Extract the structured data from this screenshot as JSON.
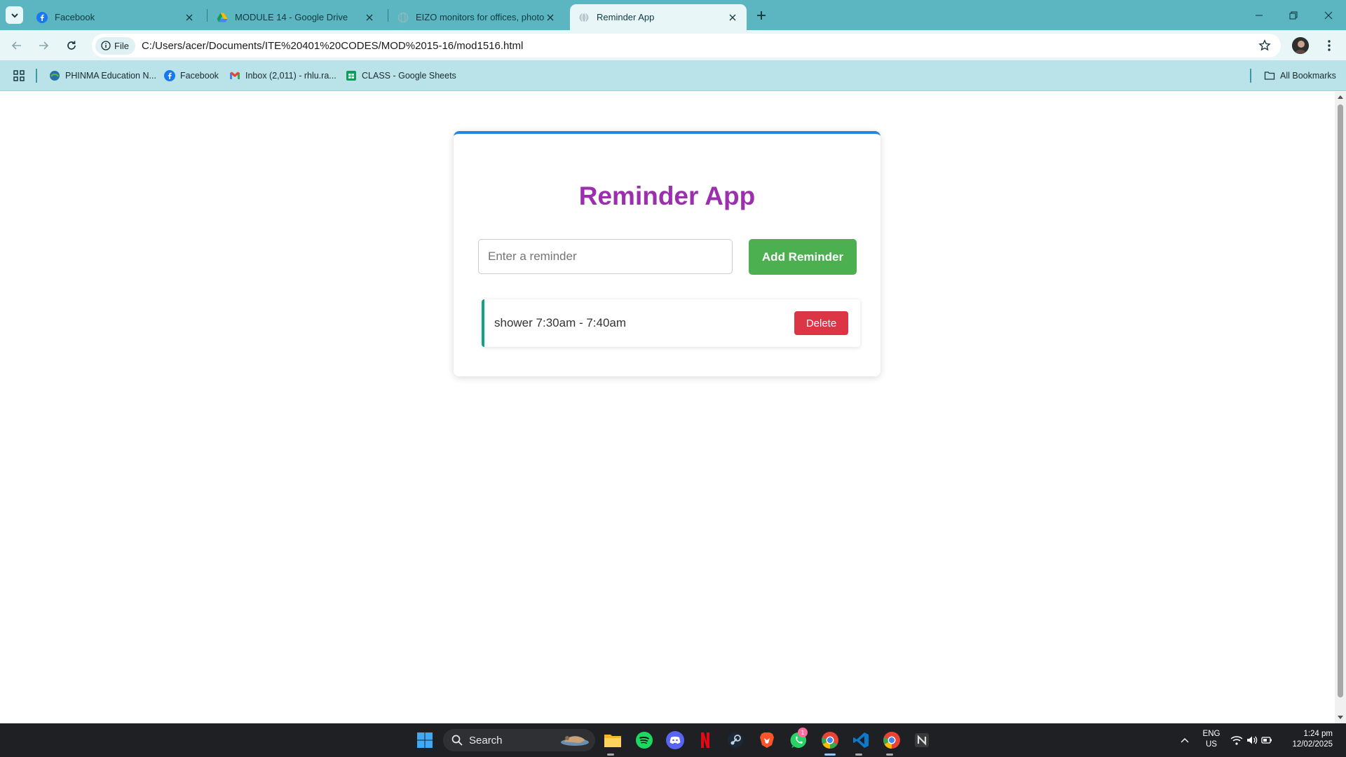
{
  "browser": {
    "tabs": [
      {
        "title": "Facebook",
        "icon": "facebook-icon"
      },
      {
        "title": "MODULE 14 - Google Drive",
        "icon": "google-drive-icon"
      },
      {
        "title": "EIZO monitors for offices, photos a",
        "icon": "globe-icon"
      },
      {
        "title": "Reminder App",
        "icon": "globe-icon",
        "active": true
      }
    ],
    "address": {
      "chip_label": "File",
      "url": "C:/Users/acer/Documents/ITE%20401%20CODES/MOD%2015-16/mod1516.html"
    },
    "bookmarks": [
      {
        "label": "PHINMA Education N...",
        "icon": "phinma-icon"
      },
      {
        "label": "Facebook",
        "icon": "facebook-icon"
      },
      {
        "label": "Inbox (2,011) - rhlu.ra...",
        "icon": "gmail-icon"
      },
      {
        "label": "CLASS - Google Sheets",
        "icon": "sheets-icon"
      }
    ],
    "all_bookmarks_label": "All Bookmarks"
  },
  "app": {
    "title": "Reminder App",
    "input_placeholder": "Enter a reminder",
    "input_value": "",
    "add_button_label": "Add Reminder",
    "delete_label": "Delete",
    "reminders": [
      {
        "text": "shower 7:30am - 7:40am"
      }
    ],
    "colors": {
      "title": "#9b2fae",
      "card_top_border": "#2387e4",
      "add_button": "#4caf50",
      "delete_button": "#dc3545",
      "item_accent": "#18a085"
    }
  },
  "taskbar": {
    "search_label": "Search",
    "apps": [
      "windows-start-icon",
      "file-explorer-icon",
      "spotify-icon",
      "discord-icon",
      "netflix-icon",
      "steam-icon",
      "brave-icon",
      "whatsapp-icon",
      "chrome-icon",
      "vscode-icon",
      "chrome-alt-icon",
      "notion-icon"
    ],
    "whatsapp_badge": "1",
    "language": "ENG",
    "region": "US",
    "time": "1:24 pm",
    "date": "12/02/2025"
  }
}
